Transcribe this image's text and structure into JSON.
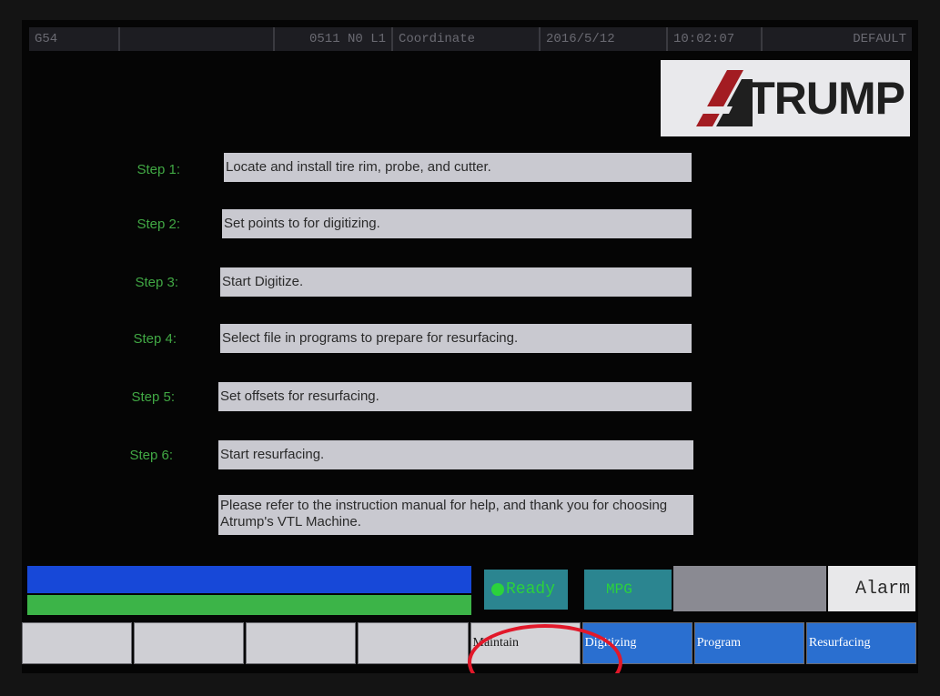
{
  "statusbar": {
    "cells": [
      "G54",
      "",
      "0511 N0 L1",
      "Coordinate",
      "2016/5/12",
      "10:02:07",
      "DEFAULT"
    ]
  },
  "logo": {
    "text": "TRUMP",
    "mark_color": "#a31c22"
  },
  "steps": [
    {
      "label": "Step 1:",
      "text": "Locate and install tire rim, probe, and cutter."
    },
    {
      "label": "Step 2:",
      "text": "Set points to for digitizing."
    },
    {
      "label": "Step 3:",
      "text": "Start Digitize."
    },
    {
      "label": "Step 4:",
      "text": "Select file in programs to prepare for resurfacing."
    },
    {
      "label": "Step 5:",
      "text": "Set offsets for resurfacing."
    },
    {
      "label": "Step 6:",
      "text": "Start resurfacing."
    }
  ],
  "note": "Please refer to the instruction manual for help, and thank you for choosing Atrump's VTL Machine.",
  "status": {
    "ready": "Ready",
    "mode": "MPG",
    "alarm": "Alarm"
  },
  "softkeys": [
    "",
    "",
    "",
    "",
    "Maintain",
    "Digitizing",
    "Program",
    "Resurfacing"
  ],
  "colors": {
    "step_label": "#41a844",
    "field_bg": "#c9c9d0",
    "softkey_active": "#2a6fd0",
    "highlight": "#e2182a"
  }
}
